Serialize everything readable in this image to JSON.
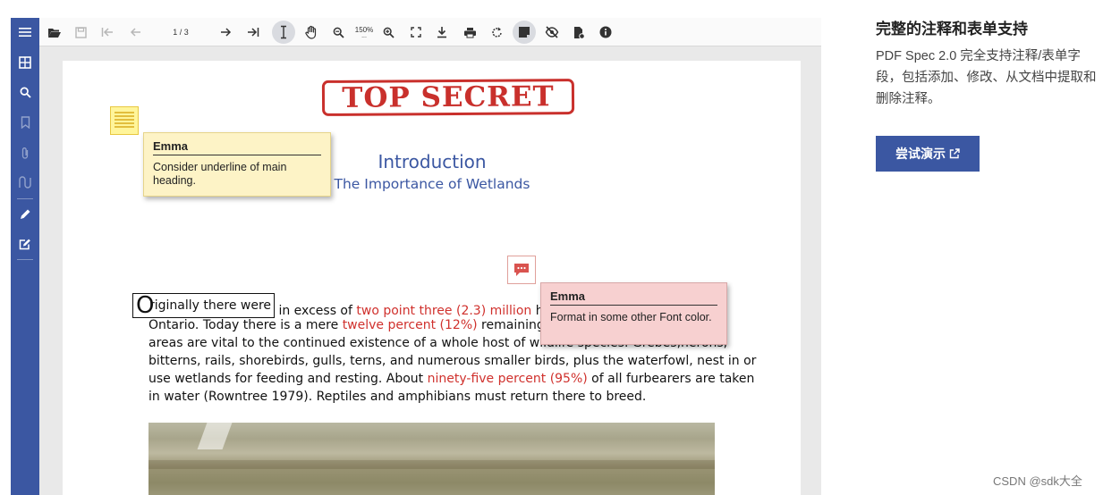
{
  "toolbar": {
    "page_indicator": "1 / 3",
    "zoom_level": "150%",
    "zoom_sub": "..."
  },
  "document": {
    "stamp_text": "TOP SECRET",
    "heading": "Introduction",
    "subheading": "The Importance of Wetlands",
    "dropcap": "O",
    "para_lines": [
      {
        "parts": [
          {
            "text": "riginally there were",
            "style": "boxed"
          },
          {
            "text": " in excess of "
          },
          {
            "text": "two point three (2.3) million",
            "style": "red"
          },
          {
            "text": " hec"
          }
        ]
      },
      {
        "parts": [
          {
            "text": "Ontario. Today there is a mere "
          },
          {
            "text": "twelve percent (12%)",
            "style": "red"
          },
          {
            "text": " remaining (Row"
          }
        ]
      },
      {
        "parts": [
          {
            "text": "areas are vital to the continued existence of a whole host of wildlife species. Grebes,herons,"
          }
        ]
      },
      {
        "parts": [
          {
            "text": "bitterns, rails, shorebirds, gulls, terns, and numerous smaller birds, plus the waterfowl, nest in or"
          }
        ]
      },
      {
        "parts": [
          {
            "text": "use wetlands for feeding and resting. About "
          },
          {
            "text": "ninety-five percent (95%)",
            "style": "red"
          },
          {
            "text": " of all furbearers are taken"
          }
        ]
      },
      {
        "parts": [
          {
            "text": "in water (Rowntree 1979). Reptiles and amphibians must return there to breed."
          }
        ]
      }
    ],
    "note_yellow": {
      "author": "Emma",
      "text": "Consider underline of main heading."
    },
    "note_pink": {
      "author": "Emma",
      "text": "Format in some other Font color."
    }
  },
  "panel": {
    "title": "完整的注释和表单支持",
    "description": "PDF Spec 2.0 完全支持注释/表单字段，包括添加、修改、从文档中提取和删除注释。",
    "demo_button": "尝试演示"
  },
  "watermark": "CSDN @sdk大全",
  "colors": {
    "accent": "#3b57a2",
    "stamp_red": "#c9302c",
    "text_red": "#d0312d",
    "note_yellow": "#fdf3c6",
    "note_pink": "#f7d0d0"
  }
}
